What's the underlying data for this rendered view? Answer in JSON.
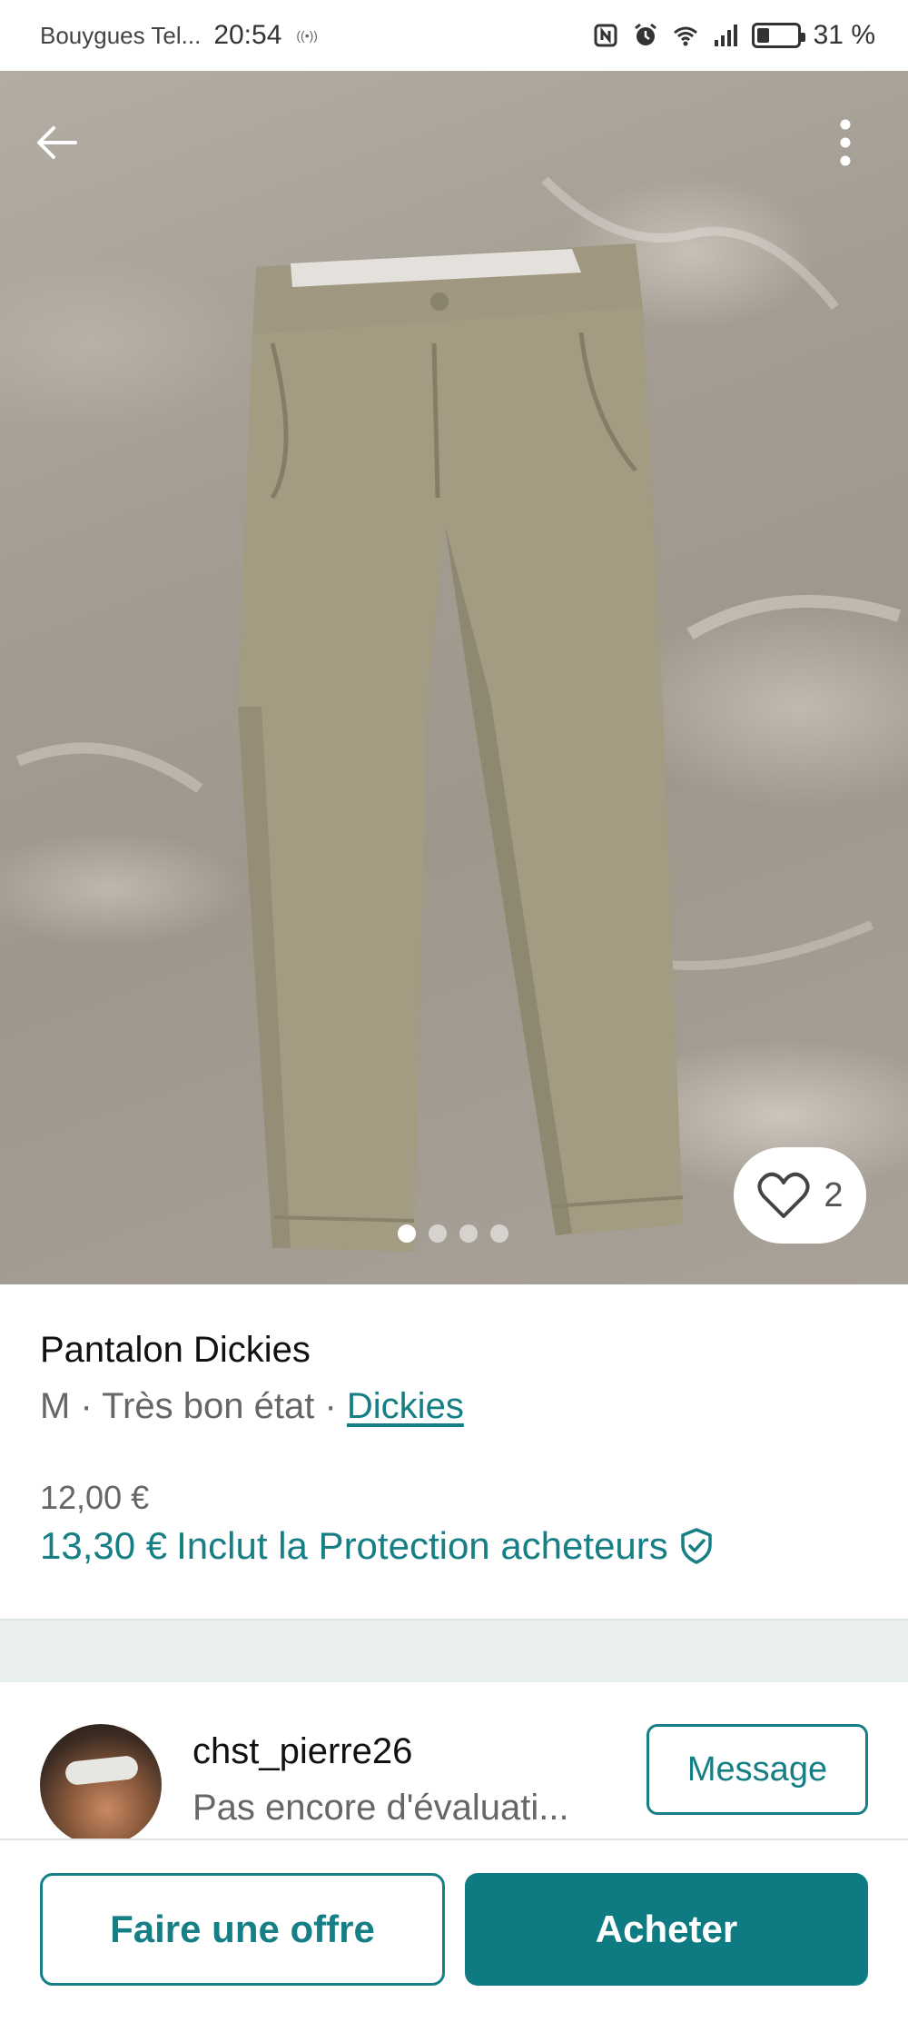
{
  "status_bar": {
    "carrier": "Bouygues Tel...",
    "time": "20:54",
    "small_indicator": "((•))",
    "battery_text": "31 %",
    "battery_level": 0.31
  },
  "hero": {
    "image_alt": "Pantalon Dickies",
    "favorites_count": "2",
    "photo_count": 4,
    "active_photo_index": 0
  },
  "item": {
    "title": "Pantalon Dickies",
    "size": "M",
    "sep1": " · ",
    "condition": "Très bon état",
    "sep2": " · ",
    "brand": "Dickies",
    "price": "12,00 €",
    "total_price": "13,30 €",
    "protection_text": "Inclut la Protection acheteurs"
  },
  "seller": {
    "username": "chst_pierre26",
    "rating_text": "Pas encore d'évaluati...",
    "message_label": "Message"
  },
  "actions": {
    "offer_label": "Faire une offre",
    "buy_label": "Acheter"
  },
  "colors": {
    "accent": "#167f86",
    "buy_button": "#0e7a82"
  }
}
